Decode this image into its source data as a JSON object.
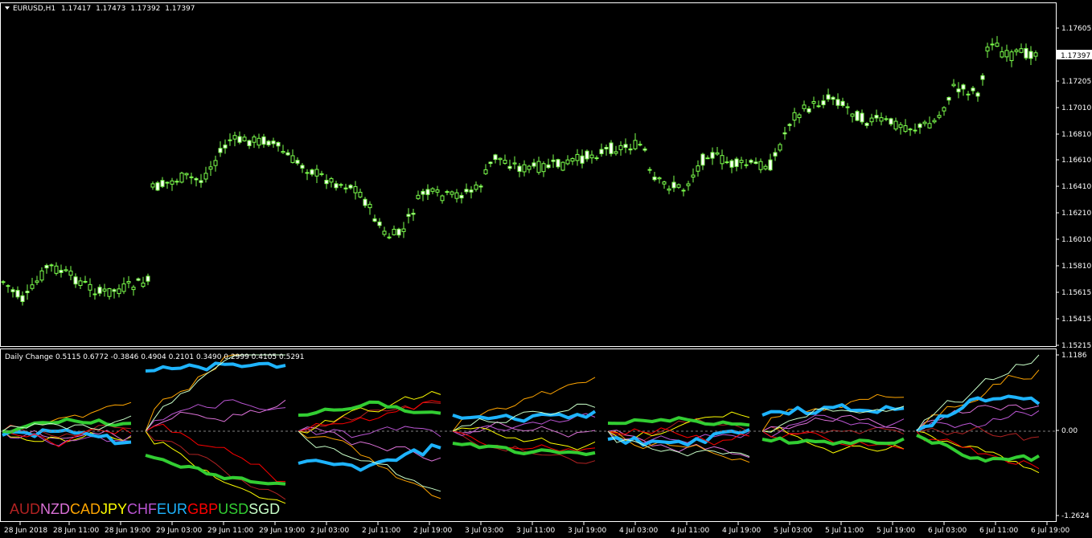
{
  "main_chart": {
    "header": {
      "symbol": "EURUSD,H1",
      "open": "1.17417",
      "high": "1.17473",
      "low": "1.17392",
      "close": "1.17397"
    },
    "current_price": "1.17397",
    "price_ticks": [
      "1.17605",
      "1.17397",
      "1.17205",
      "1.17010",
      "1.16810",
      "1.16610",
      "1.16410",
      "1.16210",
      "1.16010",
      "1.15810",
      "1.15615",
      "1.15415",
      "1.15215"
    ],
    "colors": {
      "bull": "#ffffff",
      "bear": "#000000",
      "candle_line": "#7cff4c",
      "background": "#000000",
      "frame": "#ffffff"
    }
  },
  "indicator": {
    "header": "Daily Change 0.5115 0.6772 -0.3846 0.4904 0.2101 0.3490 0.2999 0.4105 0.5291",
    "scale_ticks": [
      "1.1186",
      "0.00",
      "-1.2624"
    ],
    "currencies": [
      {
        "name": "AUD",
        "color": "#b22222"
      },
      {
        "name": "NZD",
        "color": "#da70d6"
      },
      {
        "name": "CAD",
        "color": "#ffa500"
      },
      {
        "name": "JPY",
        "color": "#ffff00"
      },
      {
        "name": "CHF",
        "color": "#ba55d3"
      },
      {
        "name": "EUR",
        "color": "#1eb4ff"
      },
      {
        "name": "GBP",
        "color": "#ff0000"
      },
      {
        "name": "USD",
        "color": "#32cd32"
      },
      {
        "name": "SGD",
        "color": "#c8ffc8"
      }
    ]
  },
  "time_axis": [
    "28 Jun 2018",
    "28 Jun 11:00",
    "28 Jun 19:00",
    "29 Jun 03:00",
    "29 Jun 11:00",
    "29 Jun 19:00",
    "2 Jul 03:00",
    "2 Jul 11:00",
    "2 Jul 19:00",
    "3 Jul 03:00",
    "3 Jul 11:00",
    "3 Jul 19:00",
    "4 Jul 03:00",
    "4 Jul 11:00",
    "4 Jul 19:00",
    "5 Jul 03:00",
    "5 Jul 11:00",
    "5 Jul 19:00",
    "6 Jul 03:00",
    "6 Jul 11:00",
    "6 Jul 19:00"
  ]
}
